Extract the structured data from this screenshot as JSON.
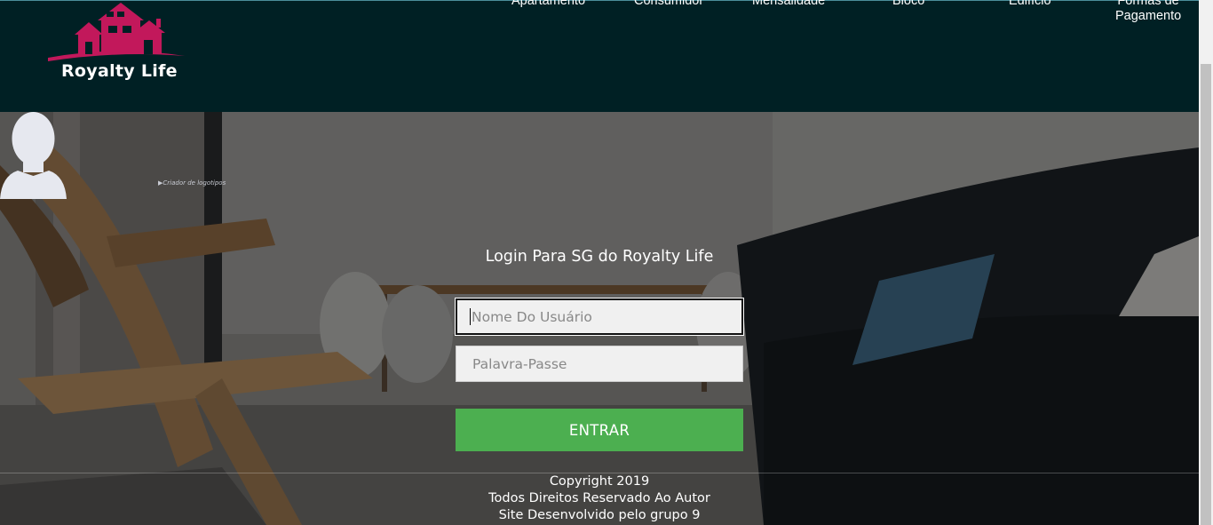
{
  "brand": {
    "name": "Royalty Life"
  },
  "nav": {
    "items": [
      {
        "label": "Apartamento"
      },
      {
        "label": "Consumidor"
      },
      {
        "label": "Mensalidade"
      },
      {
        "label": "Bloco"
      },
      {
        "label": "Edifício"
      },
      {
        "label_line1": "Formas de",
        "label_line2": "Pagamento"
      }
    ]
  },
  "hero": {
    "broken_image_alt": "Criador de logotipos"
  },
  "login": {
    "title": "Login Para SG do Royalty Life",
    "username_placeholder": "Nome Do Usuário",
    "password_placeholder": "Palavra-Passe",
    "submit_label": "ENTRAR"
  },
  "footer": {
    "copyright": "Copyright 2019",
    "rights": "Todos Direitos Reservado Ao Autor",
    "developed_by": "Site Desenvolvido pelo grupo 9"
  },
  "colors": {
    "header_bg": "#002024",
    "brand_magenta": "#c2185b",
    "button_green": "#4caf50"
  }
}
